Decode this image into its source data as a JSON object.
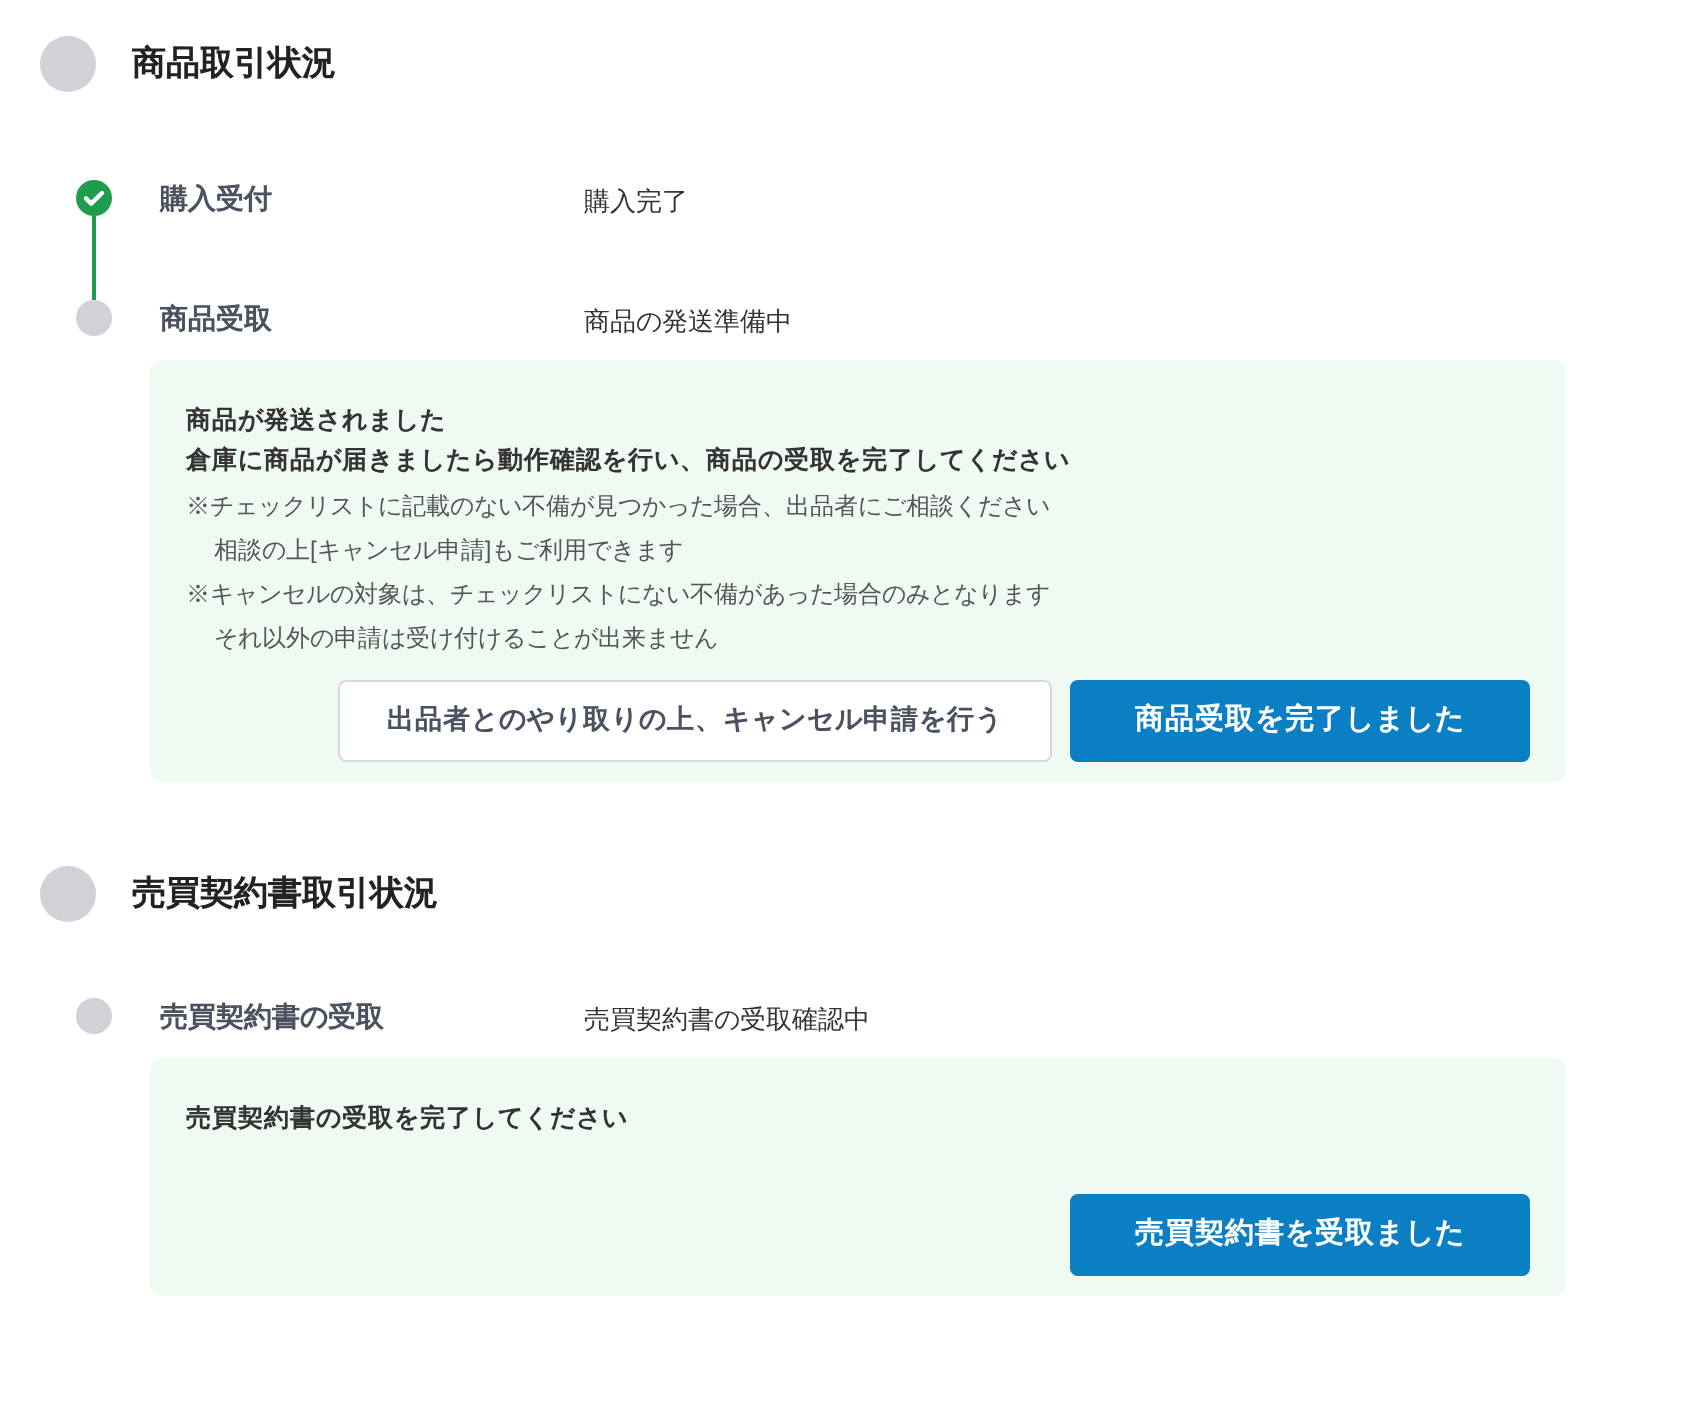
{
  "sections": [
    {
      "title": "商品取引状況",
      "steps": [
        {
          "label": "購入受付",
          "status": "購入完了",
          "done": true
        },
        {
          "label": "商品受取",
          "status": "商品の発送準備中",
          "done": false
        }
      ],
      "panel": {
        "headlines": [
          "商品が発送されました",
          "倉庫に商品が届きましたら動作確認を行い、商品の受取を完了してください"
        ],
        "notes": [
          {
            "text": "※チェックリストに記載のない不備が見つかった場合、出品者にご相談ください",
            "indent": false
          },
          {
            "text": "相談の上[キャンセル申請]もご利用できます",
            "indent": true
          },
          {
            "text": "※キャンセルの対象は、チェックリストにない不備があった場合のみとなります",
            "indent": false
          },
          {
            "text": "それ以外の申請は受け付けることが出来ません",
            "indent": true
          }
        ],
        "buttons": [
          {
            "label": "出品者とのやり取りの上、キャンセル申請を行う",
            "kind": "secondary"
          },
          {
            "label": "商品受取を完了しました",
            "kind": "primary"
          }
        ]
      }
    },
    {
      "title": "売買契約書取引状況",
      "steps": [
        {
          "label": "売買契約書の受取",
          "status": "売買契約書の受取確認中",
          "done": false
        }
      ],
      "panel": {
        "headlines": [
          "売買契約書の受取を完了してください"
        ],
        "buttons": [
          {
            "label": "売買契約書を受取ました",
            "kind": "primary"
          }
        ]
      }
    }
  ]
}
